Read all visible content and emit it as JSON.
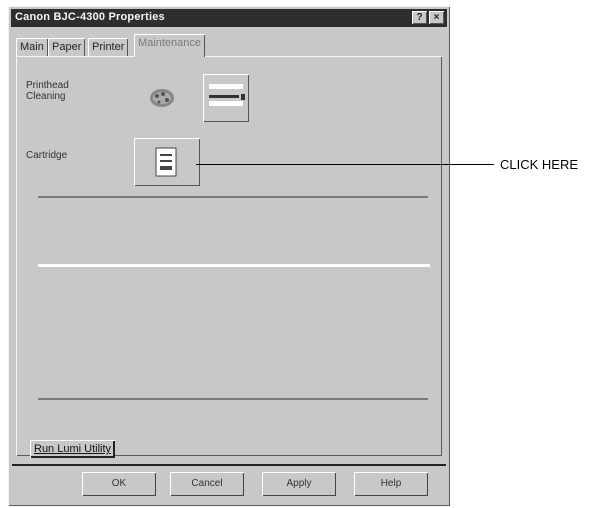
{
  "window": {
    "title": "Canon BJC-4300 Properties",
    "help_glyph": "?",
    "close_glyph": "×"
  },
  "tabs": [
    {
      "label": "Main"
    },
    {
      "label": "Paper"
    },
    {
      "label": "Printer"
    },
    {
      "label": "Maintenance"
    }
  ],
  "panel": {
    "printhead_label_line1": "Printhead",
    "printhead_label_line2": "Cleaning",
    "cartridge_label": "Cartridge"
  },
  "run_button_label": "Run Lumi Utility",
  "buttons": {
    "ok": "OK",
    "cancel": "Cancel",
    "apply": "Apply",
    "help": "Help"
  },
  "annotation": {
    "text": "CLICK HERE"
  },
  "icons": {
    "printhead": "printhead-cleaning-icon",
    "nozzle": "nozzle-check-icon",
    "cartridge": "cartridge-icon"
  }
}
